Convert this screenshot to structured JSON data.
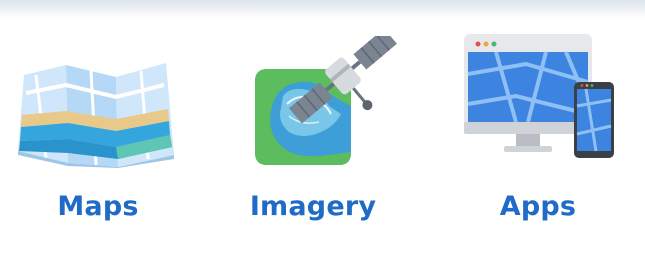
{
  "tiles": [
    {
      "label": "Maps",
      "icon": "folded-map-icon"
    },
    {
      "label": "Imagery",
      "icon": "satellite-imagery-icon"
    },
    {
      "label": "Apps",
      "icon": "devices-map-app-icon"
    }
  ],
  "colors": {
    "label": "#1f6bc7",
    "top_band": "#dde3ec"
  }
}
